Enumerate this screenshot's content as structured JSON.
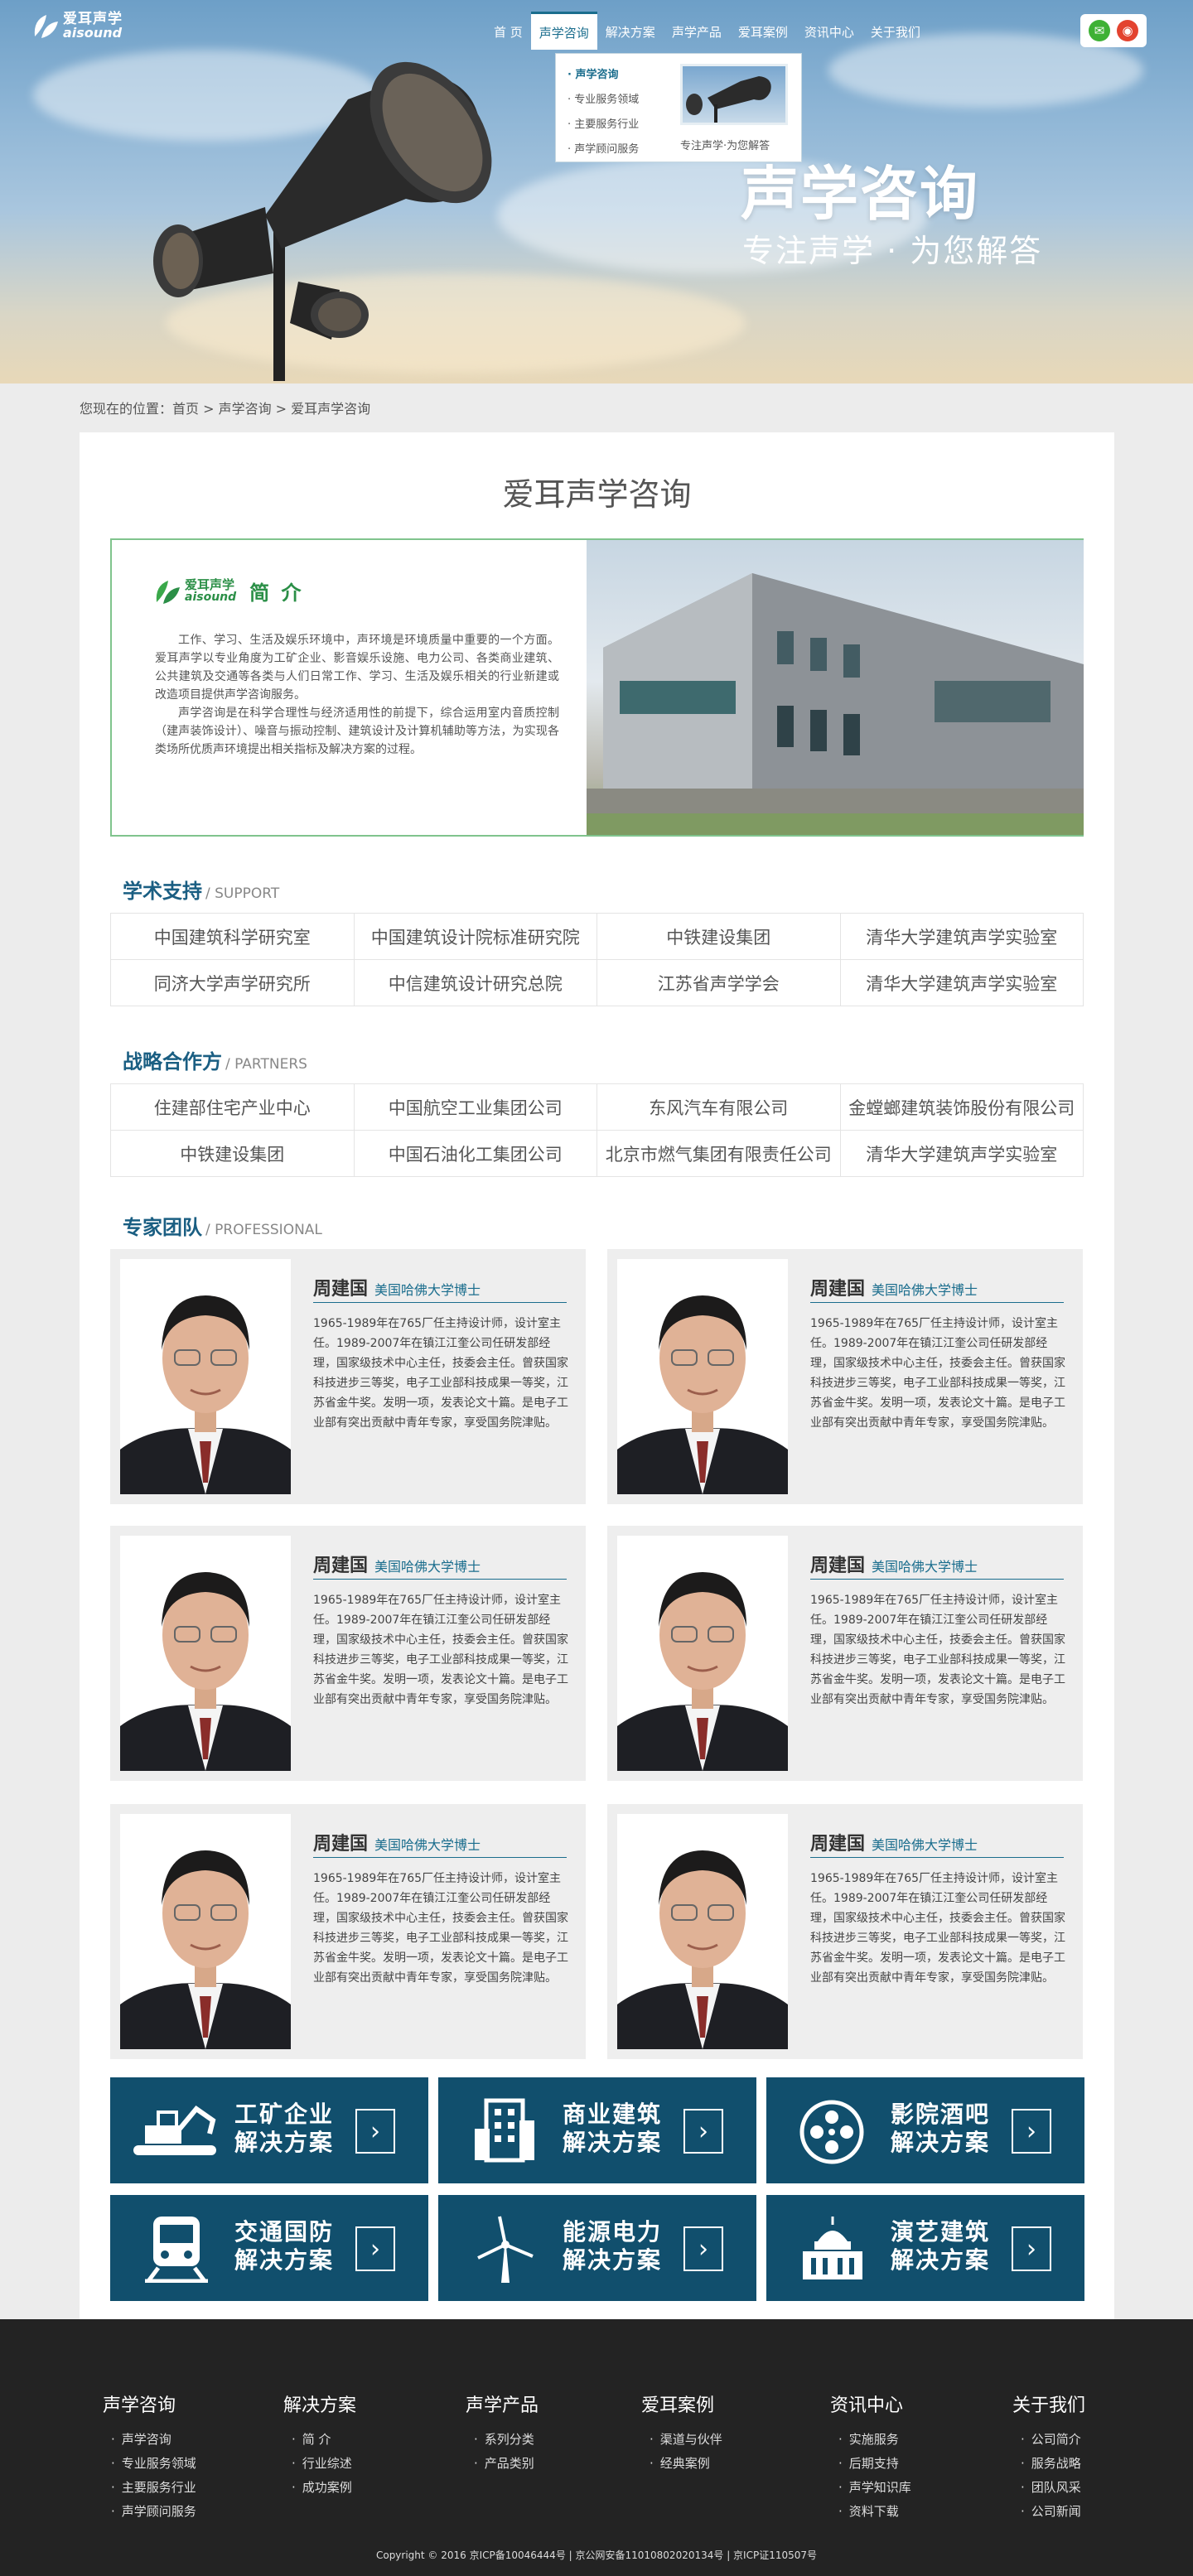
{
  "brand": {
    "cn": "爱耳声学",
    "en": "aisound"
  },
  "nav": {
    "items": [
      {
        "label": "首 页"
      },
      {
        "label": "声学咨询"
      },
      {
        "label": "解决方案"
      },
      {
        "label": "声学产品"
      },
      {
        "label": "爱耳案例"
      },
      {
        "label": "资讯中心"
      },
      {
        "label": "关于我们"
      }
    ]
  },
  "dropdown": {
    "items": [
      {
        "label": "声学咨询"
      },
      {
        "label": "专业服务领域"
      },
      {
        "label": "主要服务行业"
      },
      {
        "label": "声学顾问服务"
      }
    ],
    "caption": "专注声学·为您解答"
  },
  "hero": {
    "title": "声学咨询",
    "subtitle": "专注声学 · 为您解答"
  },
  "breadcrumb": "您现在的位置：首页 > 声学咨询 > 爱耳声学咨询",
  "main": {
    "title": "爱耳声学咨询",
    "intro": {
      "heading": "简 介",
      "p1": "工作、学习、生活及娱乐环境中，声环境是环境质量中重要的一个方面。爱耳声学以专业角度为工矿企业、影音娱乐设施、电力公司、各类商业建筑、公共建筑及交通等各类与人们日常工作、学习、生活及娱乐相关的行业新建或改造项目提供声学咨询服务。",
      "p2": "声学咨询是在科学合理性与经济适用性的前提下，综合运用室内音质控制（建声装饰设计）、噪音与振动控制、建筑设计及计算机辅助等方法，为实现各类场所优质声环境提出相关指标及解决方案的过程。"
    },
    "support": {
      "title": "学术支持",
      "en": "/ SUPPORT",
      "rows": [
        [
          "中国建筑科学研究室",
          "中国建筑设计院标准研究院",
          "中铁建设集团",
          "清华大学建筑声学实验室"
        ],
        [
          "同济大学声学研究所",
          "中信建筑设计研究总院",
          "江苏省声学学会",
          "清华大学建筑声学实验室"
        ]
      ]
    },
    "partners": {
      "title": "战略合作方",
      "en": "/ PARTNERS",
      "rows": [
        [
          "住建部住宅产业中心",
          "中国航空工业集团公司",
          "东风汽车有限公司",
          "金螳螂建筑装饰股份有限公司"
        ],
        [
          "中铁建设集团",
          "中国石油化工集团公司",
          "北京市燃气集团有限责任公司",
          "清华大学建筑声学实验室"
        ]
      ]
    },
    "experts": {
      "title": "专家团队",
      "en": "/ PROFESSIONAL",
      "cards": [
        {
          "name": "周建国",
          "title": "美国哈佛大学博士",
          "desc": "1965-1989年在765厂任主持设计师，设计室主任。1989-2007年在镇江江奎公司任研发部经理，国家级技术中心主任，技委会主任。曾获国家科技进步三等奖，电子工业部科技成果一等奖，江苏省金牛奖。发明一项，发表论文十篇。是电子工业部有突出贡献中青年专家，享受国务院津贴。"
        },
        {
          "name": "周建国",
          "title": "美国哈佛大学博士",
          "desc": "1965-1989年在765厂任主持设计师，设计室主任。1989-2007年在镇江江奎公司任研发部经理，国家级技术中心主任，技委会主任。曾获国家科技进步三等奖，电子工业部科技成果一等奖，江苏省金牛奖。发明一项，发表论文十篇。是电子工业部有突出贡献中青年专家，享受国务院津贴。"
        },
        {
          "name": "周建国",
          "title": "美国哈佛大学博士",
          "desc": "1965-1989年在765厂任主持设计师，设计室主任。1989-2007年在镇江江奎公司任研发部经理，国家级技术中心主任，技委会主任。曾获国家科技进步三等奖，电子工业部科技成果一等奖，江苏省金牛奖。发明一项，发表论文十篇。是电子工业部有突出贡献中青年专家，享受国务院津贴。"
        },
        {
          "name": "周建国",
          "title": "美国哈佛大学博士",
          "desc": "1965-1989年在765厂任主持设计师，设计室主任。1989-2007年在镇江江奎公司任研发部经理，国家级技术中心主任，技委会主任。曾获国家科技进步三等奖，电子工业部科技成果一等奖，江苏省金牛奖。发明一项，发表论文十篇。是电子工业部有突出贡献中青年专家，享受国务院津贴。"
        },
        {
          "name": "周建国",
          "title": "美国哈佛大学博士",
          "desc": "1965-1989年在765厂任主持设计师，设计室主任。1989-2007年在镇江江奎公司任研发部经理，国家级技术中心主任，技委会主任。曾获国家科技进步三等奖，电子工业部科技成果一等奖，江苏省金牛奖。发明一项，发表论文十篇。是电子工业部有突出贡献中青年专家，享受国务院津贴。"
        },
        {
          "name": "周建国",
          "title": "美国哈佛大学博士",
          "desc": "1965-1989年在765厂任主持设计师，设计室主任。1989-2007年在镇江江奎公司任研发部经理，国家级技术中心主任，技委会主任。曾获国家科技进步三等奖，电子工业部科技成果一等奖，江苏省金牛奖。发明一项，发表论文十篇。是电子工业部有突出贡献中青年专家，享受国务院津贴。"
        }
      ]
    },
    "solutions": [
      {
        "l1": "工矿企业",
        "l2": "解决方案",
        "icon": "excavator-icon"
      },
      {
        "l1": "商业建筑",
        "l2": "解决方案",
        "icon": "building-icon"
      },
      {
        "l1": "影院酒吧",
        "l2": "解决方案",
        "icon": "film-reel-icon"
      },
      {
        "l1": "交通国防",
        "l2": "解决方案",
        "icon": "train-icon"
      },
      {
        "l1": "能源电力",
        "l2": "解决方案",
        "icon": "wind-turbine-icon"
      },
      {
        "l1": "演艺建筑",
        "l2": "解决方案",
        "icon": "theater-icon"
      }
    ]
  },
  "footer": {
    "cols": [
      {
        "title": "声学咨询",
        "items": [
          "声学咨询",
          "专业服务领域",
          "主要服务行业",
          "声学顾问服务"
        ]
      },
      {
        "title": "解决方案",
        "items": [
          "简 介",
          "行业综述",
          "成功案例"
        ]
      },
      {
        "title": "声学产品",
        "items": [
          "系列分类",
          "产品类别"
        ]
      },
      {
        "title": "爱耳案例",
        "items": [
          "渠道与伙伴",
          "经典案例"
        ]
      },
      {
        "title": "资讯中心",
        "items": [
          "实施服务",
          "后期支持",
          "声学知识库",
          "资料下载"
        ]
      },
      {
        "title": "关于我们",
        "items": [
          "公司简介",
          "服务战略",
          "团队风采",
          "公司新闻"
        ]
      }
    ],
    "copyright": "Copyright © 2016 京ICP备10046444号 | 京公网安备11010802020134号 | 京ICP证110507号"
  },
  "colors": {
    "accent": "#1a6d8d",
    "solution_bg": "#114f6d",
    "intro_border": "#80c48d",
    "footer_bg": "#232323"
  }
}
